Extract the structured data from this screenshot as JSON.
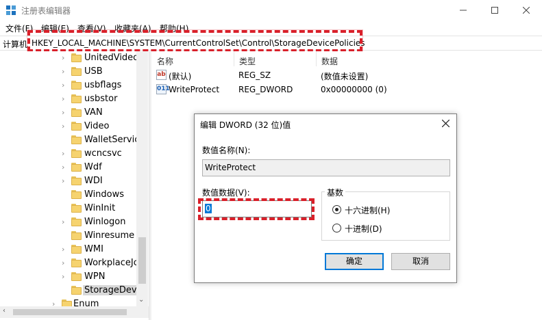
{
  "window": {
    "title": "注册表编辑器",
    "app_icon": "regedit-icon",
    "controls": {
      "minimize": "—",
      "maximize": "☐",
      "close": "✕"
    }
  },
  "menu": [
    {
      "label": "文件(F)"
    },
    {
      "label": "编辑(E)"
    },
    {
      "label": "查看(V)"
    },
    {
      "label": "收藏夹(A)"
    },
    {
      "label": "帮助(H)"
    }
  ],
  "address": {
    "label": "计算机",
    "path": "HKEY_LOCAL_MACHINE\\SYSTEM\\CurrentControlSet\\Control\\StorageDevicePolicies"
  },
  "tree": {
    "items": [
      {
        "label": "UnitedVideo",
        "expandable": true,
        "selected": false
      },
      {
        "label": "USB",
        "expandable": true,
        "selected": false
      },
      {
        "label": "usbflags",
        "expandable": true,
        "selected": false
      },
      {
        "label": "usbstor",
        "expandable": true,
        "selected": false
      },
      {
        "label": "VAN",
        "expandable": true,
        "selected": false
      },
      {
        "label": "Video",
        "expandable": true,
        "selected": false
      },
      {
        "label": "WalletService",
        "expandable": false,
        "selected": false
      },
      {
        "label": "wcncsvc",
        "expandable": true,
        "selected": false
      },
      {
        "label": "Wdf",
        "expandable": true,
        "selected": false
      },
      {
        "label": "WDI",
        "expandable": true,
        "selected": false
      },
      {
        "label": "Windows",
        "expandable": false,
        "selected": false
      },
      {
        "label": "WinInit",
        "expandable": false,
        "selected": false
      },
      {
        "label": "Winlogon",
        "expandable": true,
        "selected": false
      },
      {
        "label": "Winresume",
        "expandable": false,
        "selected": false
      },
      {
        "label": "WMI",
        "expandable": true,
        "selected": false
      },
      {
        "label": "WorkplaceJo",
        "expandable": true,
        "selected": false
      },
      {
        "label": "WPN",
        "expandable": true,
        "selected": false
      },
      {
        "label": "StorageDevic",
        "expandable": false,
        "selected": true
      },
      {
        "label": "Enum",
        "expandable": true,
        "selected": false
      }
    ]
  },
  "values": {
    "columns": {
      "name": "名称",
      "type": "类型",
      "data": "数据"
    },
    "rows": [
      {
        "icon": "ab",
        "name": "(默认)",
        "type": "REG_SZ",
        "data": "(数值未设置)"
      },
      {
        "icon": "011",
        "name": "WriteProtect",
        "type": "REG_DWORD",
        "data": "0x00000000 (0)"
      }
    ]
  },
  "dialog": {
    "title": "编辑 DWORD (32 位)值",
    "name_label": "数值名称(N):",
    "name_value": "WriteProtect",
    "data_label": "数值数据(V):",
    "data_value": "0",
    "base_label": "基数",
    "base_options": [
      {
        "label": "十六进制(H)",
        "checked": true
      },
      {
        "label": "十进制(D)",
        "checked": false
      }
    ],
    "ok_label": "确定",
    "cancel_label": "取消"
  },
  "colors": {
    "highlight": "#d9202a",
    "selection": "#0078d7",
    "folder": "#f6d36f"
  }
}
